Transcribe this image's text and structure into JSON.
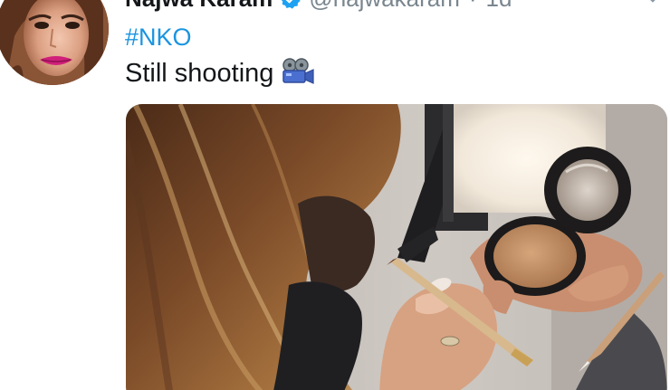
{
  "tweet": {
    "author": {
      "display_name": "Najwa Karam",
      "handle": "@najwakaram",
      "verified": true,
      "avatar_icon": "profile-photo"
    },
    "separator": "·",
    "timestamp": "1d",
    "hashtag": "#NKO",
    "text": "Still shooting",
    "emoji_icon": "movie-camera-icon",
    "menu_icon": "chevron-down-icon",
    "media": {
      "type": "photo",
      "icon": "photo-makeup-compact"
    }
  },
  "colors": {
    "link": "#1b95e0",
    "text": "#14171a",
    "muted": "#7a868f",
    "verified": "#1da1f2",
    "background": "#ffffff"
  }
}
